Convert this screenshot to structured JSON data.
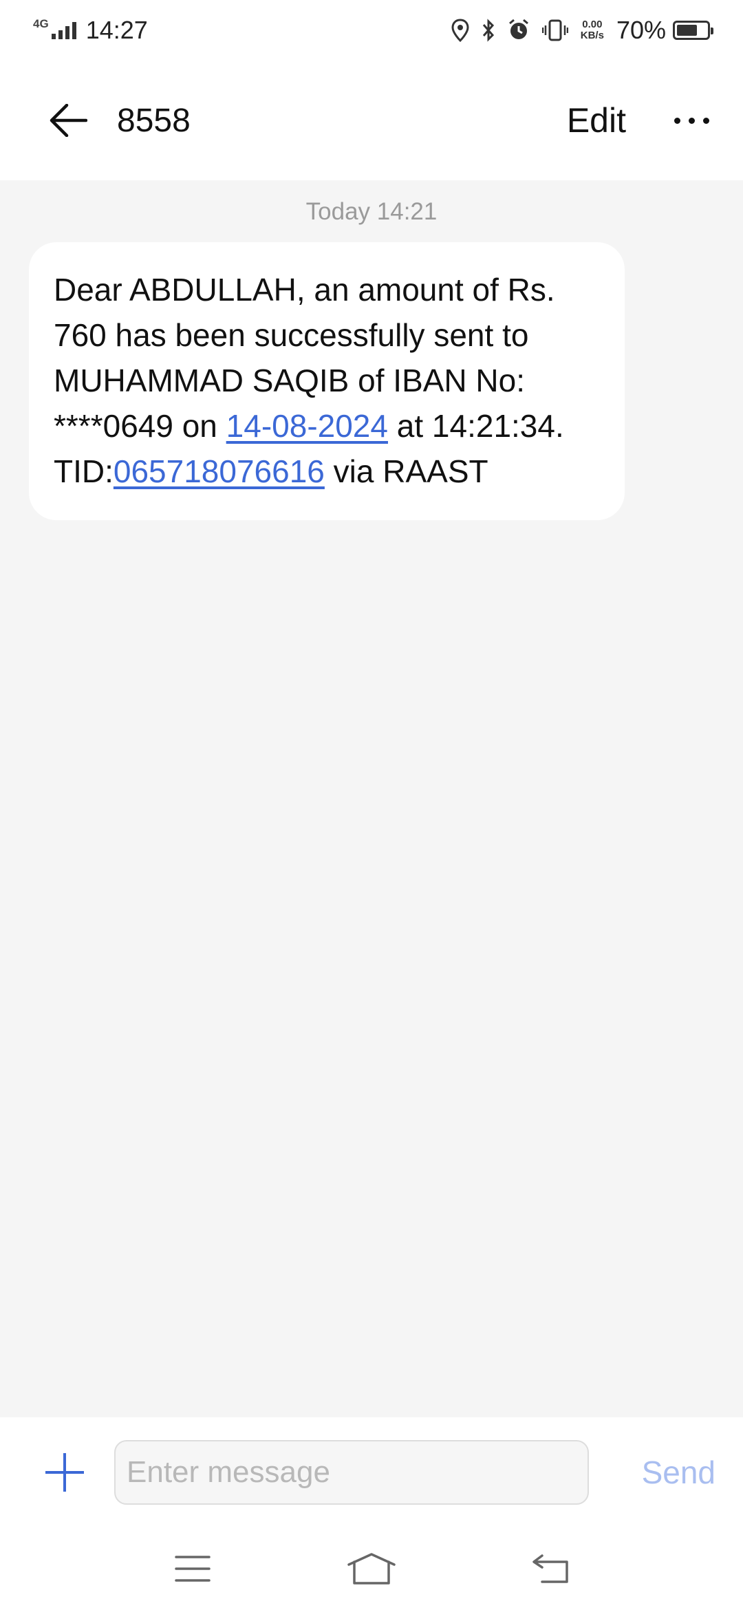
{
  "status_bar": {
    "network": "4G",
    "time": "14:27",
    "speed_value": "0.00",
    "speed_unit": "KB/s",
    "battery_percent": "70%",
    "battery_level": 0.7,
    "icons": [
      "location-icon",
      "bluetooth-icon",
      "alarm-icon",
      "vibrate-icon"
    ]
  },
  "header": {
    "title": "8558",
    "edit_label": "Edit",
    "back_icon": "arrow-left-icon",
    "more_icon": "more-horizontal-icon"
  },
  "conversation": {
    "timestamp": "Today 14:21",
    "message": {
      "part1": "Dear ABDULLAH, an amount of Rs. 760 has been successfully sent to MUHAMMAD SAQIB of IBAN No: ****0649 on ",
      "date_link": "14-08-2024",
      "part2": " at 14:21:34. TID:",
      "tid_link": "065718076616",
      "part3": " via RAAST"
    }
  },
  "composer": {
    "placeholder": "Enter message",
    "value": "",
    "send_label": "Send",
    "attach_icon": "plus-icon"
  },
  "navbar": {
    "icons": [
      "menu-icon",
      "home-icon",
      "back-icon"
    ]
  },
  "colors": {
    "accent": "#3b68d6",
    "send_disabled": "#a9bef0",
    "chat_bg": "#f5f5f5"
  }
}
